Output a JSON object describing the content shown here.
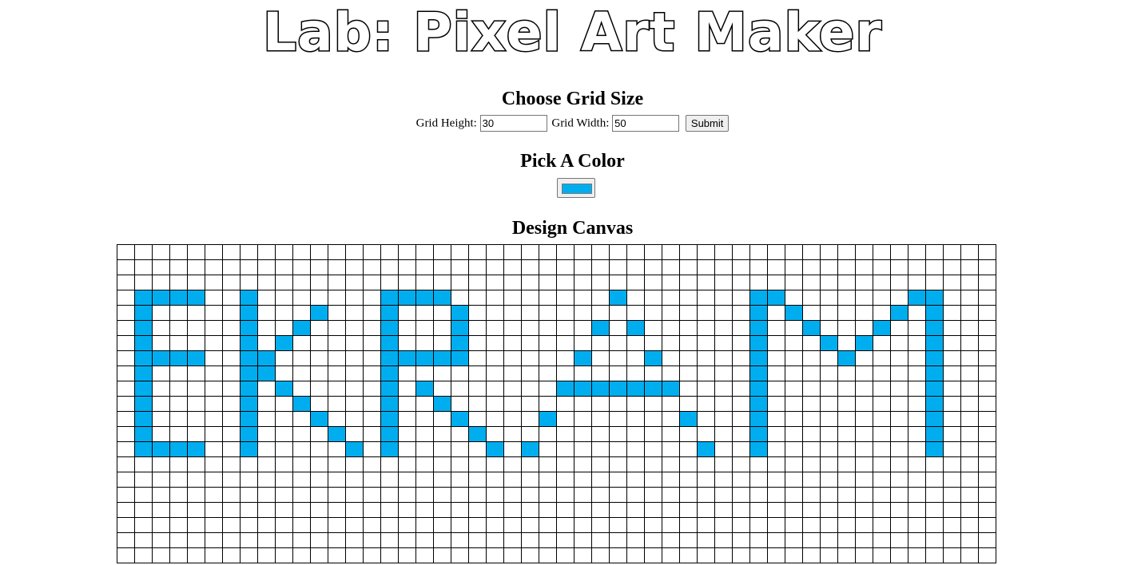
{
  "title": "Lab: Pixel Art Maker",
  "grid_form": {
    "heading": "Choose Grid Size",
    "height_label": "Grid Height:",
    "height_value": "30",
    "width_label": "Grid Width:",
    "width_value": "50",
    "submit_label": "Submit"
  },
  "color_picker": {
    "heading": "Pick A Color",
    "value": "#00aeef"
  },
  "canvas": {
    "heading": "Design Canvas",
    "fill_color": "#00aeef",
    "visible_rows": 21,
    "columns": 50,
    "filled_cells": [
      [
        3,
        1
      ],
      [
        3,
        2
      ],
      [
        3,
        3
      ],
      [
        3,
        4
      ],
      [
        4,
        1
      ],
      [
        5,
        1
      ],
      [
        6,
        1
      ],
      [
        7,
        1
      ],
      [
        7,
        2
      ],
      [
        7,
        3
      ],
      [
        7,
        4
      ],
      [
        8,
        1
      ],
      [
        9,
        1
      ],
      [
        10,
        1
      ],
      [
        11,
        1
      ],
      [
        12,
        1
      ],
      [
        13,
        1
      ],
      [
        13,
        2
      ],
      [
        13,
        3
      ],
      [
        13,
        4
      ],
      [
        3,
        7
      ],
      [
        4,
        7
      ],
      [
        5,
        7
      ],
      [
        6,
        7
      ],
      [
        7,
        7
      ],
      [
        8,
        7
      ],
      [
        9,
        7
      ],
      [
        10,
        7
      ],
      [
        11,
        7
      ],
      [
        12,
        7
      ],
      [
        13,
        7
      ],
      [
        4,
        11
      ],
      [
        5,
        10
      ],
      [
        6,
        9
      ],
      [
        7,
        8
      ],
      [
        8,
        8
      ],
      [
        9,
        9
      ],
      [
        10,
        10
      ],
      [
        11,
        11
      ],
      [
        12,
        12
      ],
      [
        13,
        13
      ],
      [
        3,
        15
      ],
      [
        3,
        16
      ],
      [
        3,
        17
      ],
      [
        3,
        18
      ],
      [
        4,
        15
      ],
      [
        4,
        19
      ],
      [
        5,
        15
      ],
      [
        5,
        19
      ],
      [
        6,
        15
      ],
      [
        6,
        19
      ],
      [
        7,
        15
      ],
      [
        7,
        16
      ],
      [
        7,
        17
      ],
      [
        7,
        18
      ],
      [
        7,
        19
      ],
      [
        8,
        15
      ],
      [
        9,
        15
      ],
      [
        10,
        15
      ],
      [
        11,
        15
      ],
      [
        12,
        15
      ],
      [
        13,
        15
      ],
      [
        9,
        17
      ],
      [
        10,
        18
      ],
      [
        11,
        19
      ],
      [
        12,
        20
      ],
      [
        13,
        21
      ],
      [
        13,
        23
      ],
      [
        11,
        24
      ],
      [
        3,
        28
      ],
      [
        5,
        27
      ],
      [
        5,
        29
      ],
      [
        7,
        26
      ],
      [
        7,
        30
      ],
      [
        9,
        25
      ],
      [
        9,
        26
      ],
      [
        9,
        27
      ],
      [
        9,
        28
      ],
      [
        9,
        29
      ],
      [
        9,
        30
      ],
      [
        9,
        31
      ],
      [
        11,
        32
      ],
      [
        13,
        33
      ],
      [
        3,
        36
      ],
      [
        4,
        36
      ],
      [
        5,
        36
      ],
      [
        6,
        36
      ],
      [
        7,
        36
      ],
      [
        8,
        36
      ],
      [
        9,
        36
      ],
      [
        10,
        36
      ],
      [
        11,
        36
      ],
      [
        12,
        36
      ],
      [
        13,
        36
      ],
      [
        3,
        37
      ],
      [
        4,
        38
      ],
      [
        5,
        39
      ],
      [
        6,
        40
      ],
      [
        7,
        41
      ],
      [
        6,
        42
      ],
      [
        5,
        43
      ],
      [
        4,
        44
      ],
      [
        3,
        45
      ],
      [
        3,
        46
      ],
      [
        4,
        46
      ],
      [
        5,
        46
      ],
      [
        6,
        46
      ],
      [
        7,
        46
      ],
      [
        8,
        46
      ],
      [
        9,
        46
      ],
      [
        10,
        46
      ],
      [
        11,
        46
      ],
      [
        12,
        46
      ],
      [
        13,
        46
      ]
    ]
  }
}
